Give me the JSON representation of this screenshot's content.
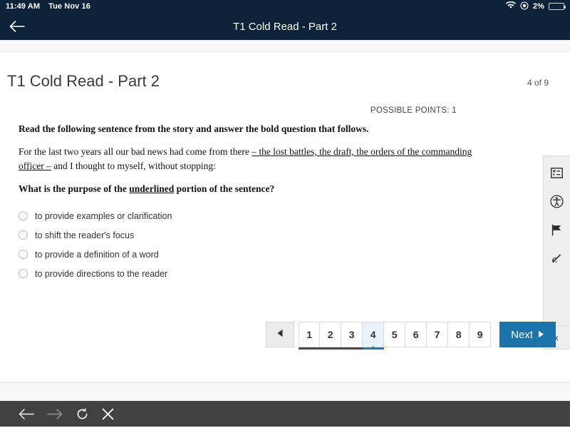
{
  "status_bar": {
    "time": "11:49 AM",
    "date": "Tue Nov 16",
    "battery_percent": "2%",
    "wifi_icon": "wifi-icon",
    "dnd_icon": "do-not-disturb-icon",
    "battery_icon": "battery-icon"
  },
  "header": {
    "back_icon": "back-arrow-icon",
    "title": "T1 Cold Read - Part 2"
  },
  "page": {
    "title": "T1 Cold Read - Part 2",
    "counter": "4 of 9",
    "possible_points": "POSSIBLE POINTS: 1"
  },
  "question": {
    "instruction": "Read the following sentence from the story and answer the bold question that follows.",
    "passage_pre": "For the last two years all our bad news had come from there ",
    "passage_underlined": "– the lost battles, the draft, the orders of the commanding officer –",
    "passage_post": " and I thought to myself, without stopping:",
    "prompt_pre": "What is the purpose of the ",
    "prompt_underlined": "underlined",
    "prompt_post": " portion of the sentence?",
    "options": [
      {
        "label": "to provide examples or clarification",
        "selected": false
      },
      {
        "label": " to shift the reader's focus",
        "selected": false
      },
      {
        "label": "to provide a definition of a word",
        "selected": false
      },
      {
        "label": "to provide directions to the reader",
        "selected": false
      }
    ]
  },
  "tool_rail": {
    "tools": [
      {
        "icon": "reference-sheet-icon",
        "name": "reference-tool"
      },
      {
        "icon": "accessibility-icon",
        "name": "accessibility-tool"
      },
      {
        "icon": "flag-icon",
        "name": "flag-question-tool"
      },
      {
        "icon": "answer-eliminator-icon",
        "name": "answer-eliminator-tool"
      }
    ],
    "collapse_icon": "chevron-left-icon"
  },
  "pagination": {
    "prev_icon": "triangle-left-icon",
    "pages": [
      "1",
      "2",
      "3",
      "4",
      "5",
      "6",
      "7",
      "8",
      "9"
    ],
    "current_page": "4",
    "visited_through": "4",
    "next_label": "Next",
    "next_icon": "triangle-right-icon"
  },
  "browser_bar": {
    "back_icon": "arrow-left-icon",
    "forward_icon": "arrow-right-icon",
    "reload_icon": "reload-icon",
    "close_icon": "close-x-icon"
  },
  "colors": {
    "header_bg": "#0b2239",
    "accent_blue": "#1a73ab",
    "active_page_bg": "#eaf3fa",
    "browser_bar_bg": "#414141"
  }
}
